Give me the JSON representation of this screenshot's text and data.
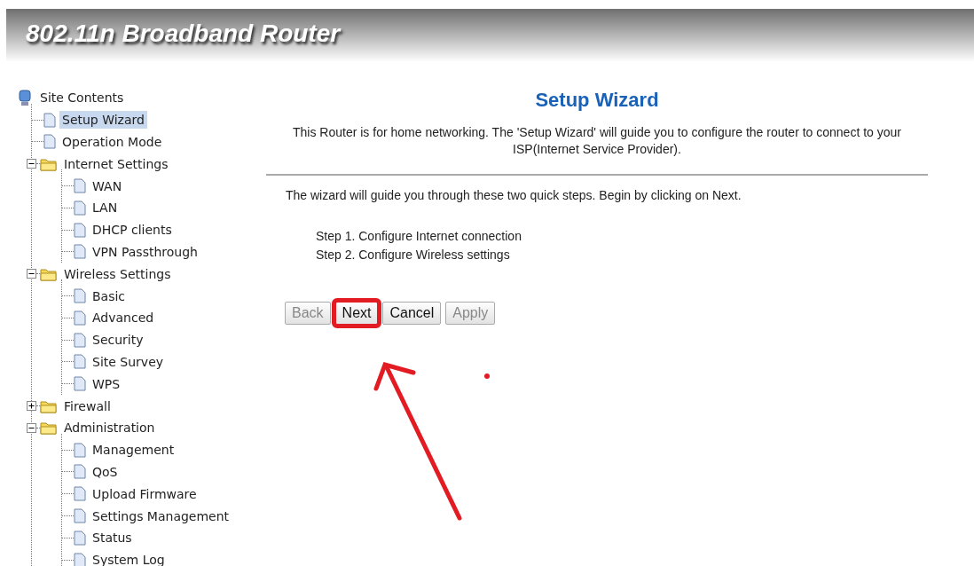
{
  "banner": {
    "title": "802.11n Broadband Router"
  },
  "sidebar": {
    "root": "Site Contents",
    "items": [
      {
        "label": "Setup Wizard",
        "kind": "page",
        "selected": true
      },
      {
        "label": "Operation Mode",
        "kind": "page",
        "selected": false
      },
      {
        "label": "Internet Settings",
        "kind": "folder",
        "selected": false,
        "expanded": true,
        "children": [
          {
            "label": "WAN",
            "kind": "page",
            "selected": false
          },
          {
            "label": "LAN",
            "kind": "page",
            "selected": false
          },
          {
            "label": "DHCP clients",
            "kind": "page",
            "selected": false
          },
          {
            "label": "VPN Passthrough",
            "kind": "page",
            "selected": false
          }
        ]
      },
      {
        "label": "Wireless Settings",
        "kind": "folder",
        "selected": false,
        "expanded": true,
        "children": [
          {
            "label": "Basic",
            "kind": "page",
            "selected": false
          },
          {
            "label": "Advanced",
            "kind": "page",
            "selected": false
          },
          {
            "label": "Security",
            "kind": "page",
            "selected": false
          },
          {
            "label": "Site Survey",
            "kind": "page",
            "selected": false
          },
          {
            "label": "WPS",
            "kind": "page",
            "selected": false
          }
        ]
      },
      {
        "label": "Firewall",
        "kind": "folder",
        "selected": false,
        "expanded": false
      },
      {
        "label": "Administration",
        "kind": "folder",
        "selected": false,
        "expanded": true,
        "children": [
          {
            "label": "Management",
            "kind": "page",
            "selected": false
          },
          {
            "label": "QoS",
            "kind": "page",
            "selected": false
          },
          {
            "label": "Upload Firmware",
            "kind": "page",
            "selected": false
          },
          {
            "label": "Settings Management",
            "kind": "page",
            "selected": false
          },
          {
            "label": "Status",
            "kind": "page",
            "selected": false
          },
          {
            "label": "System Log",
            "kind": "page",
            "selected": false
          }
        ]
      }
    ]
  },
  "main": {
    "heading": "Setup Wizard",
    "description": "This Router is for home networking. The 'Setup Wizard' will guide you to configure the router to connect to your ISP(Internet Service Provider).",
    "intro": "The wizard will guide you through these two quick steps. Begin by clicking on Next.",
    "steps": [
      "Step 1. Configure Internet connection",
      "Step 2. Configure Wireless settings"
    ],
    "buttons": [
      {
        "label": "Back",
        "disabled": true,
        "highlighted": false
      },
      {
        "label": "Next",
        "disabled": false,
        "highlighted": true
      },
      {
        "label": "Cancel",
        "disabled": false,
        "highlighted": false
      },
      {
        "label": "Apply",
        "disabled": true,
        "highlighted": false
      }
    ]
  }
}
